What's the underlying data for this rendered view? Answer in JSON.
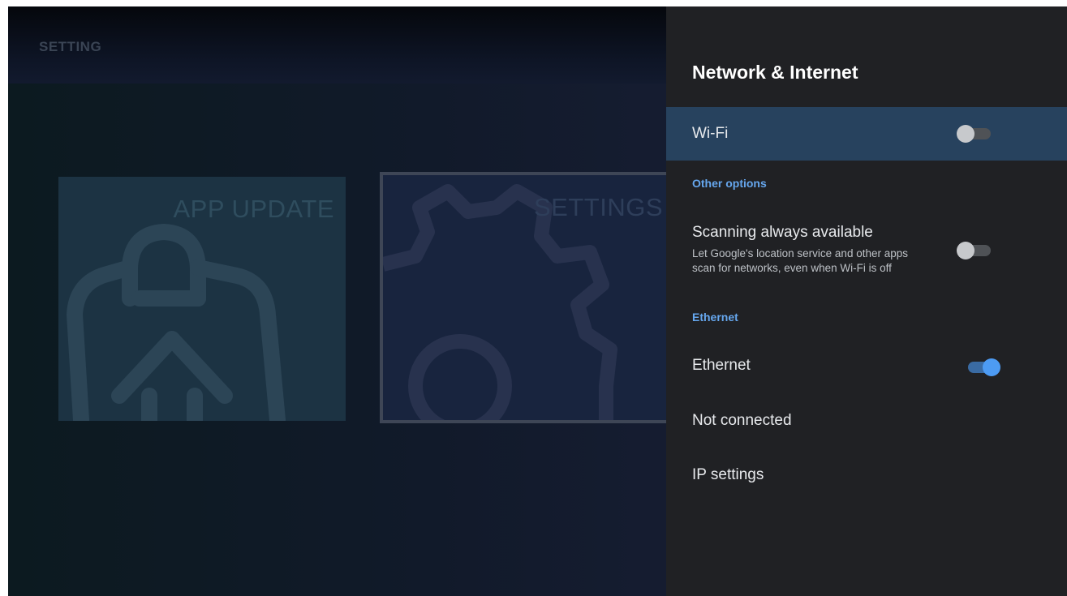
{
  "background": {
    "brand": "SETTING",
    "tiles": [
      {
        "label": "APP UPDATE",
        "icon": "app-update-icon"
      },
      {
        "label": "SETTINGS",
        "icon": "gear-icon"
      }
    ]
  },
  "panel": {
    "title": "Network & Internet",
    "wifi": {
      "label": "Wi-Fi",
      "toggle_on": false
    },
    "other_options_header": "Other options",
    "scanning": {
      "label": "Scanning always available",
      "description_line1": "Let Google's location service and other apps",
      "description_line2": "scan for networks, even when Wi-Fi is off",
      "toggle_on": false
    },
    "ethernet_header": "Ethernet",
    "ethernet": {
      "label": "Ethernet",
      "toggle_on": true
    },
    "status": "Not connected",
    "ip_settings": "IP settings"
  },
  "colors": {
    "panel_bg": "#202124",
    "selected_row": "#27425e",
    "section_accent": "#66a7ee",
    "toggle_on": "#4d9bf3"
  }
}
